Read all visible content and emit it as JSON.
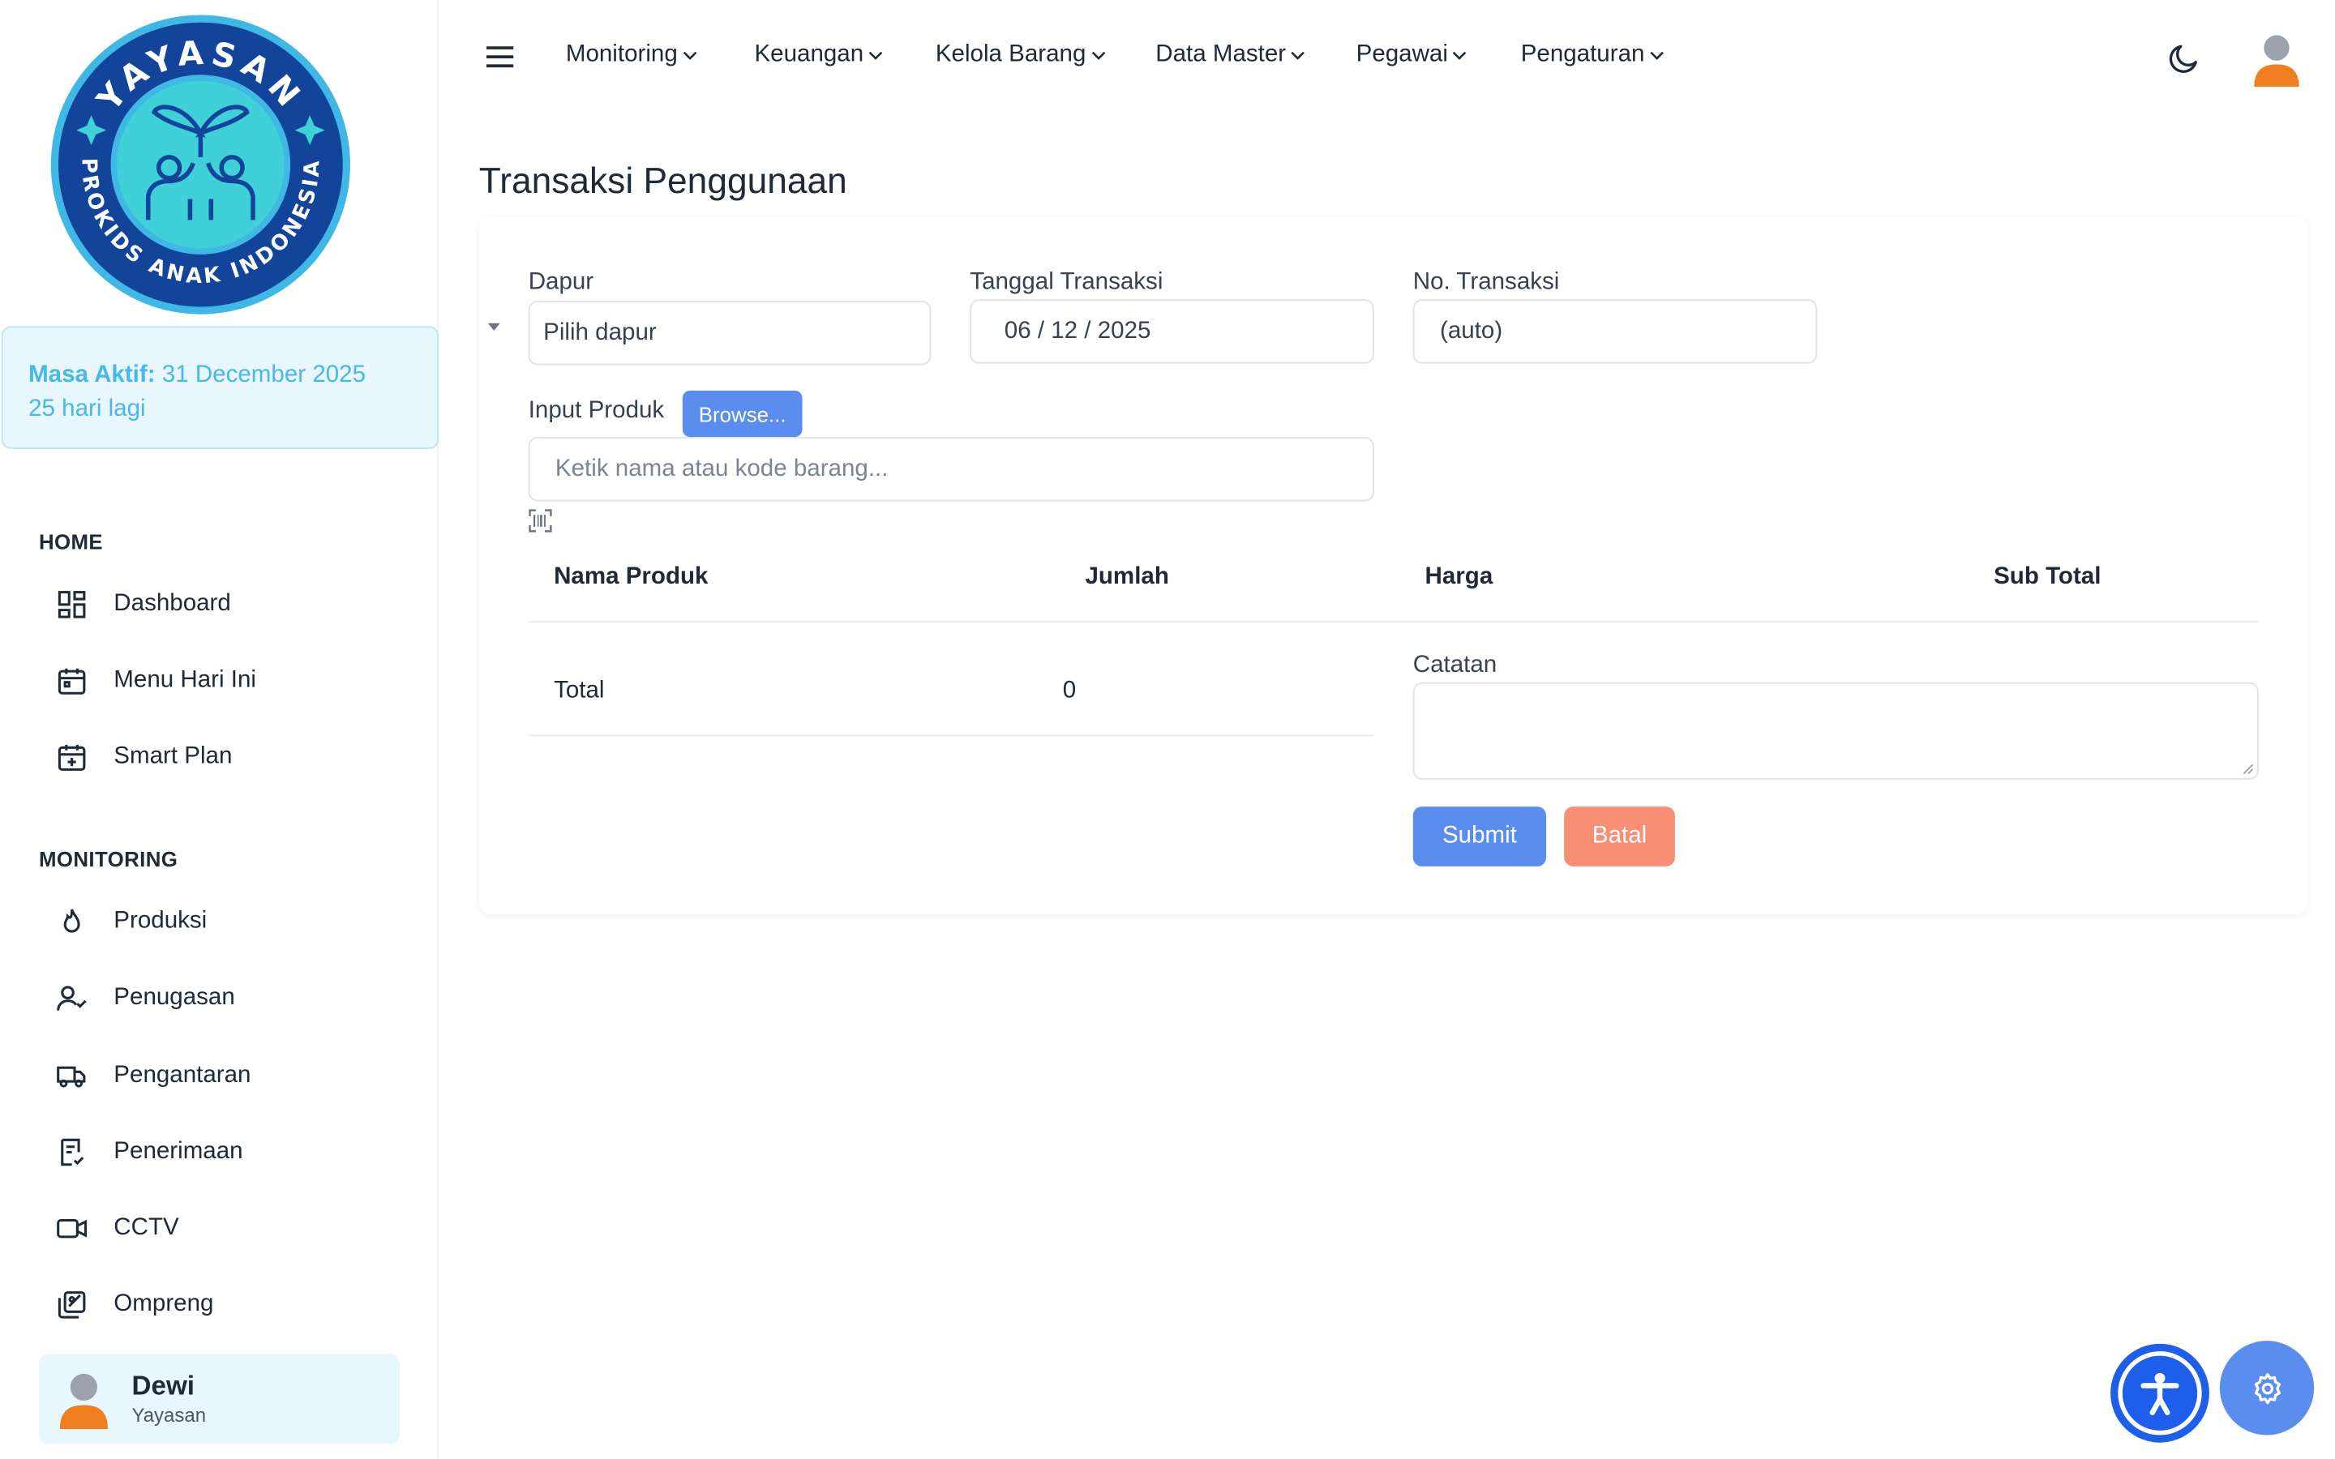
{
  "brand": {
    "logo_text_top": "YAYASAN",
    "logo_text_bottom": "PROKIDS ANAK INDONESIA"
  },
  "masa_aktif": {
    "label": "Masa Aktif:",
    "date": "31 December 2025",
    "remaining": "25 hari lagi"
  },
  "sidebar": {
    "sections": [
      {
        "title": "HOME",
        "items": [
          {
            "label": "Dashboard",
            "icon": "dashboard-grid-icon"
          },
          {
            "label": "Menu Hari Ini",
            "icon": "calendar-icon"
          },
          {
            "label": "Smart Plan",
            "icon": "calendar-plus-icon"
          }
        ]
      },
      {
        "title": "MONITORING",
        "items": [
          {
            "label": "Produksi",
            "icon": "flame-icon"
          },
          {
            "label": "Penugasan",
            "icon": "user-check-icon"
          },
          {
            "label": "Pengantaran",
            "icon": "truck-icon"
          },
          {
            "label": "Penerimaan",
            "icon": "receipt-check-icon"
          },
          {
            "label": "CCTV",
            "icon": "video-icon"
          },
          {
            "label": "Ompreng",
            "icon": "tray-icon"
          }
        ]
      }
    ],
    "user": {
      "name": "Dewi",
      "role": "Yayasan"
    }
  },
  "topnav": {
    "items": [
      "Monitoring",
      "Keuangan",
      "Kelola Barang",
      "Data Master",
      "Pegawai",
      "Pengaturan"
    ]
  },
  "page": {
    "title": "Transaksi Penggunaan",
    "form": {
      "dapur_label": "Dapur",
      "dapur_value": "Pilih dapur",
      "tanggal_label": "Tanggal Transaksi",
      "tanggal_value": "06 / 12 / 2025",
      "no_label": "No. Transaksi",
      "no_value": "(auto)",
      "input_produk_label": "Input Produk",
      "browse_label": "Browse...",
      "produk_placeholder": "Ketik nama atau kode barang...",
      "catatan_label": "Catatan",
      "catatan_value": ""
    },
    "table": {
      "headers": [
        "Nama Produk",
        "Jumlah",
        "Harga",
        "Sub Total"
      ],
      "rows": [],
      "total_label": "Total",
      "total_value": "0"
    },
    "actions": {
      "submit": "Submit",
      "batal": "Batal"
    }
  },
  "colors": {
    "primary": "#5b8def",
    "danger": "#f88e74",
    "info_bg": "#e8f6fd",
    "info_text": "#47b8e8",
    "logo_navy": "#12449a",
    "logo_teal": "#3fd0d8"
  }
}
